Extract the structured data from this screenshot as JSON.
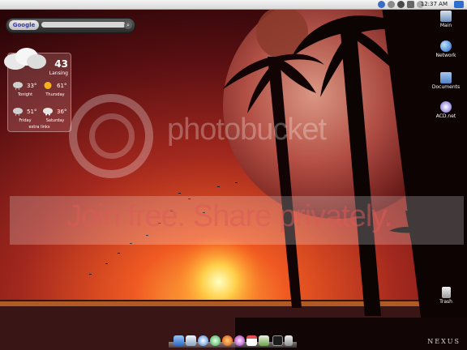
{
  "menubar": {
    "clock": "12:37 AM",
    "status_icons": [
      "bluetooth-icon",
      "volume-icon",
      "wifi-icon",
      "battery-icon",
      "user-icon",
      "spotlight-icon"
    ]
  },
  "search_widget": {
    "logo": "Google",
    "placeholder": ""
  },
  "weather": {
    "current_temp": "43",
    "city": "Lansing",
    "forecast": [
      {
        "label": "Tonight",
        "temp": "33°",
        "icon": "rain-cloud-icon"
      },
      {
        "label": "Thursday",
        "temp": "61°",
        "icon": "sun-icon"
      },
      {
        "label": "Friday",
        "temp": "51°",
        "icon": "rain-cloud-icon"
      },
      {
        "label": "Saturday",
        "temp": "36°",
        "icon": "snow-cloud-icon"
      }
    ],
    "extra_links": "extra links"
  },
  "desktop_icons": [
    {
      "label": "Main",
      "icon": "hard-drive-icon"
    },
    {
      "label": "Network",
      "icon": "network-globe-icon"
    },
    {
      "label": "Documents",
      "icon": "folder-icon"
    },
    {
      "label": "ACD.net",
      "icon": "acd-net-icon"
    },
    {
      "label": "Trash",
      "icon": "trash-icon"
    }
  ],
  "watermark": {
    "logo_text": "photobucket",
    "banner_text": "Join free. Share privately."
  },
  "dock": {
    "items": [
      "finder",
      "mail",
      "safari",
      "itunes",
      "firefox",
      "messenger",
      "ical",
      "preview",
      "terminal",
      "trash"
    ]
  },
  "signature": "NEXUS"
}
